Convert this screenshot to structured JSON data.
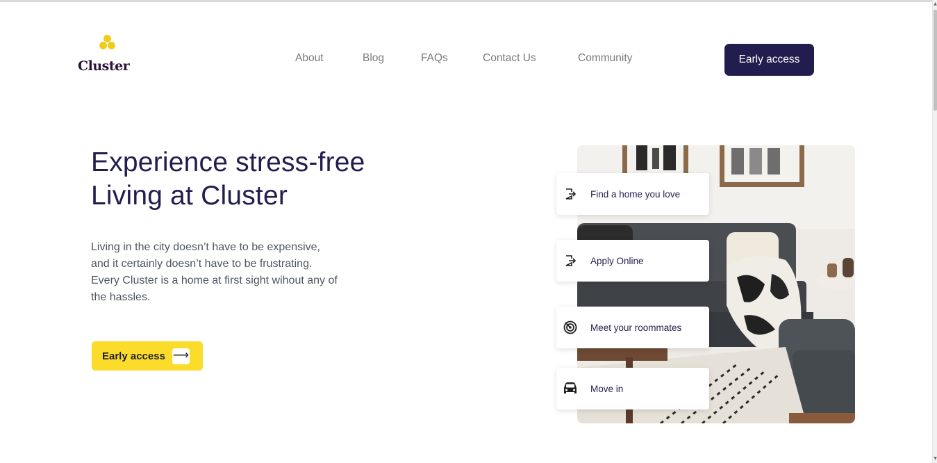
{
  "brand": {
    "name": "Cluster",
    "accent_color": "#f2cc1d",
    "primary_color": "#211d4f"
  },
  "nav": {
    "items": [
      {
        "label": "About"
      },
      {
        "label": "Blog"
      },
      {
        "label": "FAQs"
      },
      {
        "label": "Contact Us"
      },
      {
        "label": "Community"
      }
    ],
    "cta_label": "Early access"
  },
  "hero": {
    "title_line1": "Experience stress-free",
    "title_line2": "Living at Cluster",
    "description_lines": [
      "Living in the city doesn’t have to be expensive,",
      "and it certainly doesn’t have to be frustrating.",
      "Every Cluster is a home at first sight wihout any of",
      "the hassles."
    ],
    "cta_label": "Early access",
    "cta_icon": "arrow-right-icon"
  },
  "steps": [
    {
      "label": "Find a home you love",
      "icon": "sign-in-icon"
    },
    {
      "label": "Apply Online",
      "icon": "sign-in-icon"
    },
    {
      "label": "Meet your roommates",
      "icon": "radar-icon"
    },
    {
      "label": "Move in",
      "icon": "car-icon"
    }
  ]
}
